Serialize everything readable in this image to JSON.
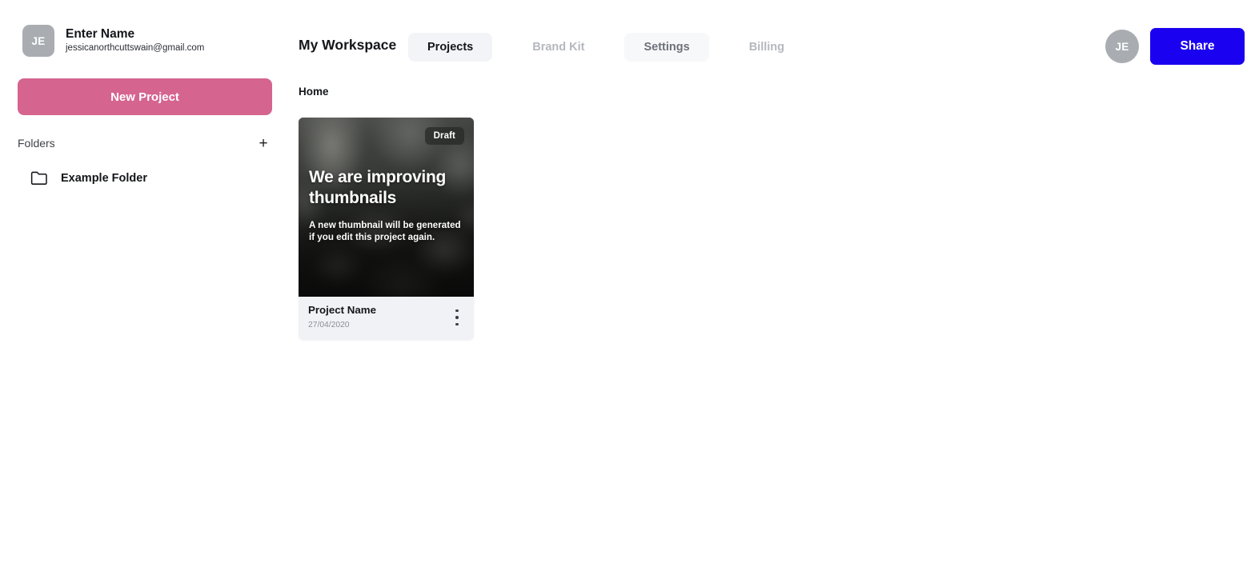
{
  "sidebar": {
    "user": {
      "avatar_initials": "JE",
      "name": "Enter Name",
      "email": "jessicanorthcuttswain@gmail.com"
    },
    "new_project_button": "New Project",
    "folders_label": "Folders",
    "add_folder_icon": "plus-icon",
    "folders": [
      {
        "name": "Example Folder",
        "icon": "folder-icon"
      }
    ],
    "accent_pink": "#d5648f"
  },
  "header": {
    "workspace_title": "My Workspace",
    "tabs": [
      {
        "label": "Projects",
        "state": "active"
      },
      {
        "label": "Brand Kit",
        "state": "muted"
      },
      {
        "label": "Settings",
        "state": "semi"
      },
      {
        "label": "Billing",
        "state": "muted"
      }
    ],
    "avatar_initials": "JE",
    "share_button": "Share",
    "share_button_color": "#1a01ef"
  },
  "main": {
    "breadcrumb": "Home",
    "projects": [
      {
        "badge": "Draft",
        "thumb_headline": "We are improving thumbnails",
        "thumb_subtext": "A new thumbnail will be generated if you edit this project again.",
        "title": "Project Name",
        "date": "27/04/2020",
        "menu_icon": "kebab-menu-icon"
      }
    ]
  }
}
